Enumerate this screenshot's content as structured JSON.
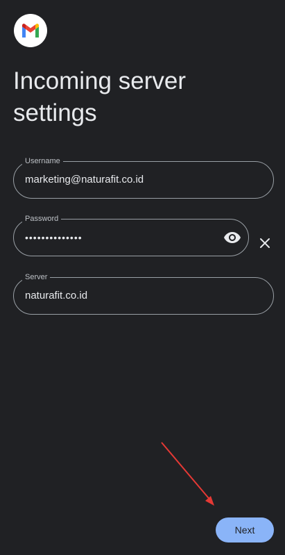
{
  "app": {
    "logo_icon": "gmail-logo-icon"
  },
  "page": {
    "title": "Incoming server settings"
  },
  "fields": {
    "username": {
      "label": "Username",
      "value": "marketing@naturafit.co.id"
    },
    "password": {
      "label": "Password",
      "value": "••••••••••••••",
      "toggle_icon": "eye-icon",
      "clear_icon": "close-icon"
    },
    "server": {
      "label": "Server",
      "value": "naturafit.co.id"
    }
  },
  "actions": {
    "next_label": "Next"
  },
  "colors": {
    "background": "#202124",
    "accent": "#8ab4f8",
    "outline": "#9aa0a6",
    "annotation_arrow": "#e53935"
  }
}
